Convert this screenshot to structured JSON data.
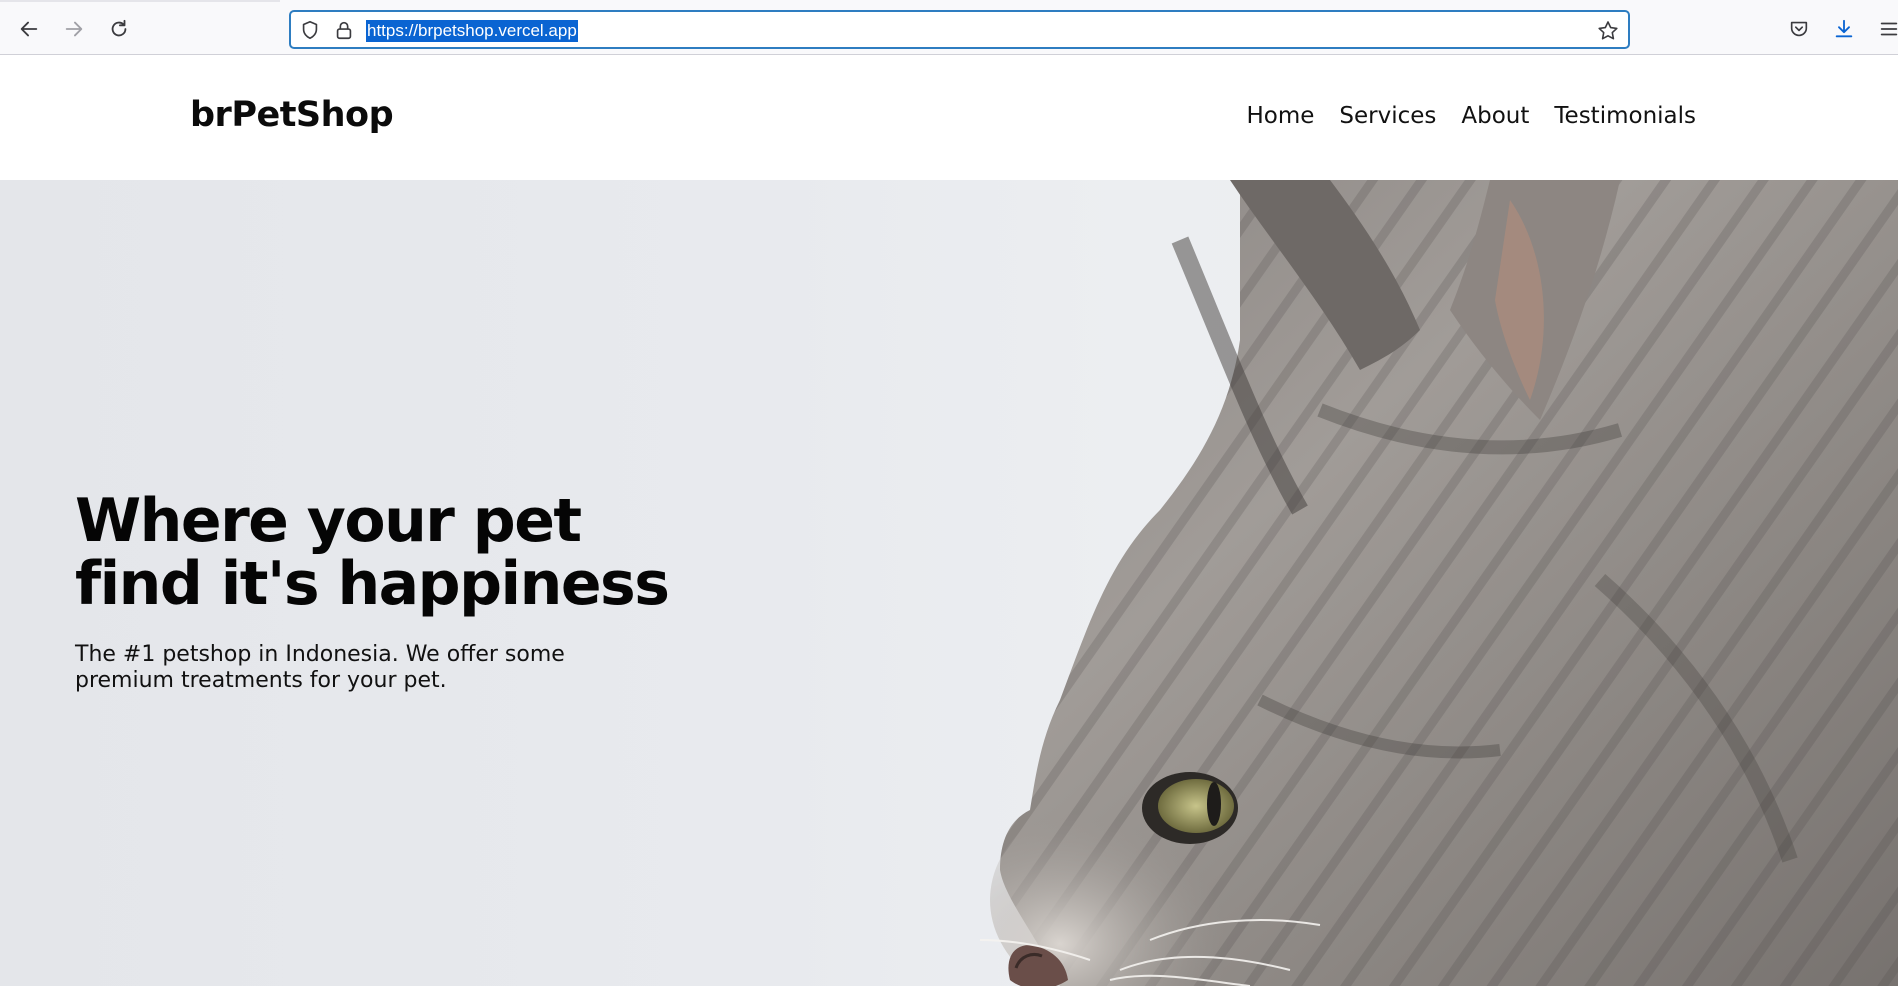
{
  "browser": {
    "url": "https://brpetshop.vercel.app",
    "accent_color": "#0a64d2"
  },
  "site": {
    "logo": "brPetShop",
    "nav": [
      {
        "label": "Home"
      },
      {
        "label": "Services"
      },
      {
        "label": "About"
      },
      {
        "label": "Testimonials"
      }
    ]
  },
  "hero": {
    "title_line1": "Where your pet",
    "title_line2": "find it's happiness",
    "subtitle": "The #1 petshop in Indonesia. We offer some premium treatments for your pet.",
    "background_color": "#e8eaee"
  },
  "icons": [
    "back-arrow-icon",
    "forward-arrow-icon",
    "reload-icon",
    "shield-icon",
    "lock-icon",
    "star-icon",
    "pocket-icon",
    "download-icon",
    "menu-icon"
  ]
}
